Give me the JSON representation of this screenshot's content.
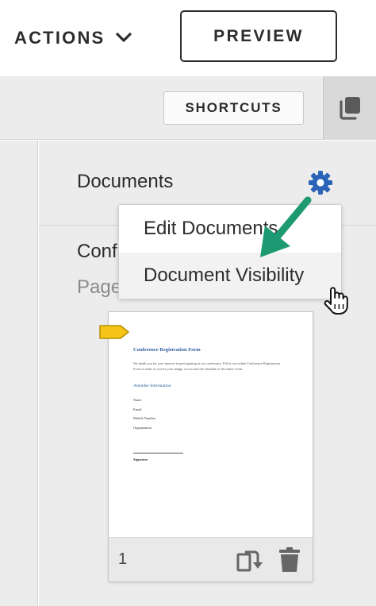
{
  "header": {
    "actions_label": "ACTIONS",
    "preview_label": "PREVIEW"
  },
  "toolbar": {
    "shortcuts_label": "SHORTCUTS",
    "copy_icon": "copy-icon"
  },
  "panel": {
    "title": "Documents",
    "settings_icon": "gear-icon",
    "document_name": "Conf",
    "document_pages": "Page"
  },
  "menu": {
    "items": [
      {
        "label": "Edit Documents"
      },
      {
        "label": "Document Visibility"
      }
    ]
  },
  "thumbnail": {
    "title": "Conference Registration Form",
    "intro": "We thank you for your interest in participating in our conference. Fill in our online Conference Registration Form in order to receive your badge, access and the schedule of the entire event.",
    "section": "Attendee Information",
    "fields": [
      "Name",
      "Email",
      "Mobile Number",
      "Organization"
    ],
    "signature_label": "Signature",
    "page_number": "1"
  },
  "colors": {
    "accent_blue": "#2a63b8",
    "annotation_green": "#1e9a72",
    "tag_yellow": "#f5c518",
    "text_dark": "#2c2c2c",
    "panel_bg": "#ececec"
  }
}
